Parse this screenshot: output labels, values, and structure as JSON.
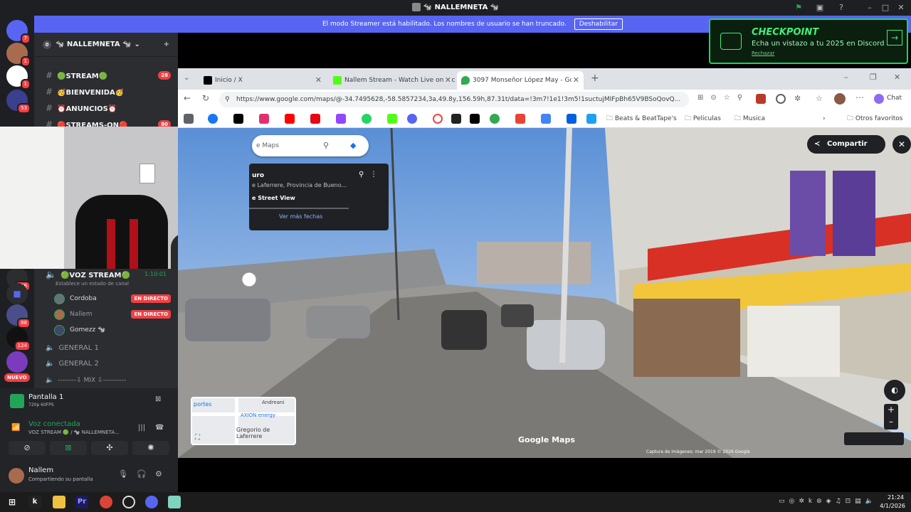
{
  "window": {
    "title": "🐄 NALLEMNETA 🐄"
  },
  "banner": {
    "text": "El modo Streamer está habilitado. Los nombres de usuario se han truncado.",
    "button": "Deshabilitar"
  },
  "checkpoint": {
    "title": "CHECKPOINT",
    "subtitle": "Echa un vistazo a tu 2025 en Discord",
    "dismiss": "Rechazar"
  },
  "guild_badges": [
    "7",
    "1",
    "1",
    "53",
    "156",
    "88",
    "124",
    "NUEVO"
  ],
  "server": {
    "count": "0",
    "name": "🐄 NALLEMNETA 🐄"
  },
  "channels": [
    {
      "name": "🟢STREAM🟢",
      "count": "28"
    },
    {
      "name": "🥳BIENVENIDA🥳",
      "count": ""
    },
    {
      "name": "⏰ANUNCIOS⏰",
      "count": ""
    },
    {
      "name": "🔴STREAMS-ON🔴",
      "count": "80"
    }
  ],
  "voice": {
    "name": "🟢VOZ STREAM🟢",
    "timer": "1:10:01",
    "status": "Establece un estado de canal",
    "users": [
      {
        "name": "Cordoba",
        "live": "EN DIRECTO"
      },
      {
        "name": "Nallem",
        "live": "EN DIRECTO"
      },
      {
        "name": "Gomezz 🐄",
        "live": ""
      }
    ],
    "others": [
      "GENERAL 1",
      "GENERAL 2",
      "--------⇩ MIX ⇩----------"
    ]
  },
  "screen_share": {
    "title": "Pantalla 1",
    "quality": "720p 60FPS"
  },
  "connection": {
    "label": "Voz conectada",
    "detail": "VOZ STREAM 🟢 / 🐄 NALLEMNETA..."
  },
  "user": {
    "name": "Nallem",
    "status": "Compartiendo su pantalla"
  },
  "tabs": [
    {
      "label": "Inicio / X",
      "color": "#000000"
    },
    {
      "label": "Nallem Stream - Watch Live on Kick",
      "color": "#53fc18"
    },
    {
      "label": "3097 Monseñor López May - Goo",
      "color": "#34a853"
    }
  ],
  "url": "https://www.google.com/maps/@-34.7495628,-58.5857234,3a,49.8y,156.59h,87.31t/data=!3m7!1e1!3m5!1suctujMIFpBh65V9BSoQovQ...",
  "chat_label": "Chat",
  "bookmarks": [
    "Beats & BeatTape's",
    "Peliculas",
    "Musica",
    "Otros favoritos"
  ],
  "maps": {
    "search_placeholder": "e Maps",
    "place_title": "uro",
    "place_address": "e Laferrere, Provincia de Bueno...",
    "source": "e Street View",
    "more_dates": "Ver más fechas",
    "share": "Compartir",
    "watermark": "Google Maps",
    "credit": "Captura de imágenes: mar 2019   © 2026 Google",
    "minimap_labels": [
      "portes",
      "Andreani",
      "AXION energy",
      "Gregorio de Laferrere"
    ]
  },
  "clock": {
    "time": "21:24",
    "date": "4/1/2026"
  }
}
